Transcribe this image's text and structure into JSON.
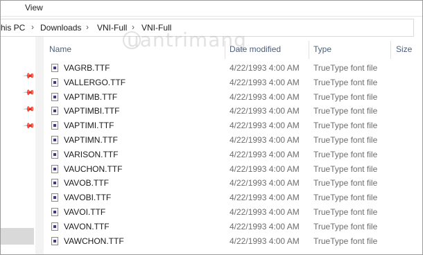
{
  "menu": {
    "items": [
      "",
      "View"
    ]
  },
  "breadcrumb": {
    "items": [
      "his PC",
      "Downloads",
      "VNI-Full",
      "VNI-Full"
    ]
  },
  "nav": {
    "pins": [
      "pin",
      "pin",
      "pin",
      "pin"
    ]
  },
  "columns": {
    "name": "Name",
    "date": "Date modified",
    "type": "Type",
    "size": "Size"
  },
  "files": [
    {
      "name": "VAGRB.TTF",
      "date": "4/22/1993 4:00 AM",
      "type": "TrueType font file"
    },
    {
      "name": "VALLERGO.TTF",
      "date": "4/22/1993 4:00 AM",
      "type": "TrueType font file"
    },
    {
      "name": "VAPTIMB.TTF",
      "date": "4/22/1993 4:00 AM",
      "type": "TrueType font file"
    },
    {
      "name": "VAPTIMBI.TTF",
      "date": "4/22/1993 4:00 AM",
      "type": "TrueType font file"
    },
    {
      "name": "VAPTIMI.TTF",
      "date": "4/22/1993 4:00 AM",
      "type": "TrueType font file"
    },
    {
      "name": "VAPTIMN.TTF",
      "date": "4/22/1993 4:00 AM",
      "type": "TrueType font file"
    },
    {
      "name": "VARISON.TTF",
      "date": "4/22/1993 4:00 AM",
      "type": "TrueType font file"
    },
    {
      "name": "VAUCHON.TTF",
      "date": "4/22/1993 4:00 AM",
      "type": "TrueType font file"
    },
    {
      "name": "VAVOB.TTF",
      "date": "4/22/1993 4:00 AM",
      "type": "TrueType font file"
    },
    {
      "name": "VAVOBI.TTF",
      "date": "4/22/1993 4:00 AM",
      "type": "TrueType font file"
    },
    {
      "name": "VAVOI.TTF",
      "date": "4/22/1993 4:00 AM",
      "type": "TrueType font file"
    },
    {
      "name": "VAVON.TTF",
      "date": "4/22/1993 4:00 AM",
      "type": "TrueType font file"
    },
    {
      "name": "VAWCHON.TTF",
      "date": "4/22/1993 4:00 AM",
      "type": "TrueType font file"
    }
  ],
  "watermark": "uantrimang"
}
